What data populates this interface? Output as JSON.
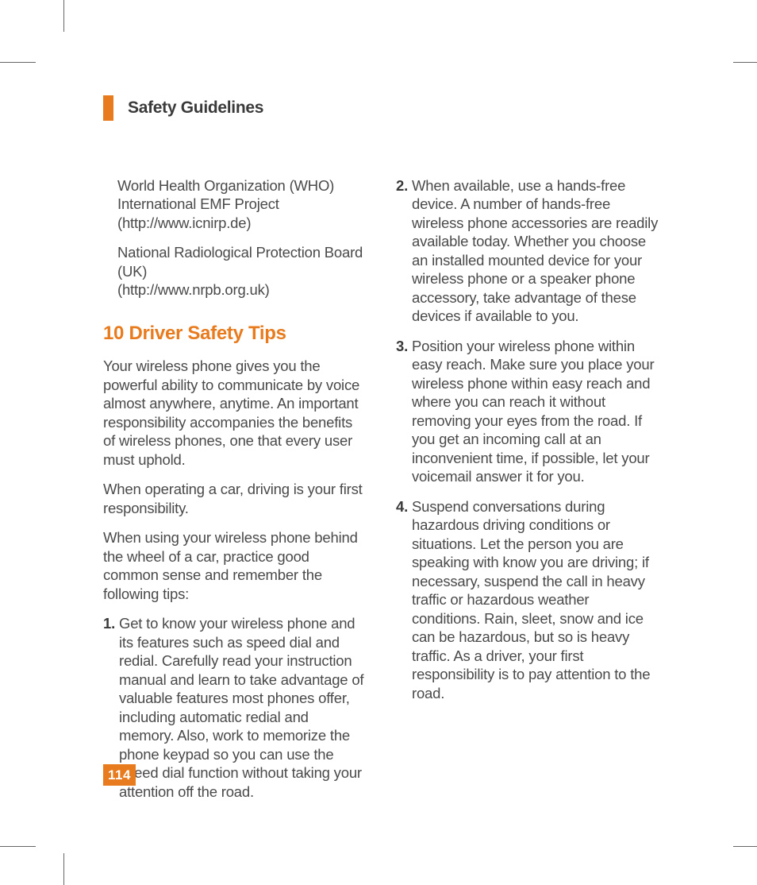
{
  "header": {
    "title": "Safety Guidelines"
  },
  "left": {
    "ref1a": "World Health Organization (WHO)",
    "ref1b": "International EMF Project",
    "ref1c": "(http://www.icnirp.de)",
    "ref2a": "National Radiological Protection Board (UK)",
    "ref2b": "(http://www.nrpb.org.uk)",
    "heading": "10 Driver Safety Tips",
    "p1": "Your wireless phone gives you the powerful ability to communicate by voice almost anywhere, anytime. An important responsibility accompanies the benefits of wireless phones, one that every user must uphold.",
    "p2": "When operating a car, driving is your first responsibility.",
    "p3": "When using your wireless phone behind the wheel of a car, practice good common sense and remember the following tips:",
    "tip1_num": "1.",
    "tip1": "Get to know your wireless phone and its features such as speed dial and redial. Carefully read your instruction manual and learn to take advantage of valuable features most phones offer, including automatic redial and memory. Also, work to memorize the phone keypad so you can use the speed dial function without taking your attention off the road."
  },
  "right": {
    "tip2_num": "2.",
    "tip2": "When available, use a hands-free device. A number of hands-free wireless phone accessories are readily available today. Whether you choose an installed mounted device for your wireless phone or a speaker phone accessory, take advantage of these devices if available to you.",
    "tip3_num": "3.",
    "tip3": "Position your wireless phone within easy reach. Make sure you place your wireless phone within easy reach and where you can reach it without removing your eyes from the road. If you get an incoming call at an inconvenient time, if possible, let your voicemail answer it for you.",
    "tip4_num": "4.",
    "tip4": "Suspend conversations during hazardous driving conditions or situations. Let the person you are speaking with know you are driving; if necessary, suspend the call in heavy traffic or hazardous weather conditions. Rain, sleet, snow and ice can be hazardous, but so is heavy traffic. As a driver, your first responsibility is to pay attention to the road."
  },
  "page_number": "114"
}
